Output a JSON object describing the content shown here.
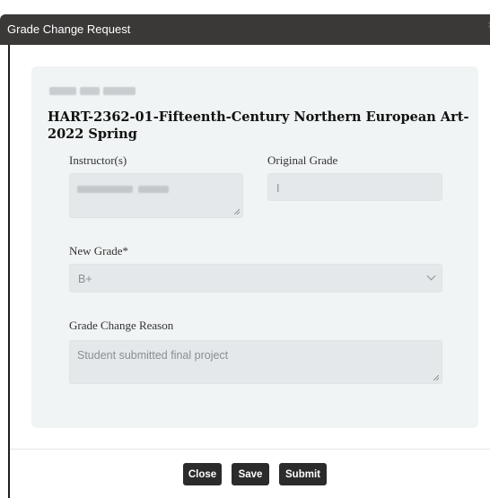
{
  "dialog": {
    "title": "Grade Change Request",
    "close_glyph": "×"
  },
  "course": {
    "title": "HART-2362-01-Fifteenth-Century Northern European Art-2022 Spring"
  },
  "fields": {
    "instructor_label": "Instructor(s)",
    "original_grade_label": "Original Grade",
    "original_grade_value": "I",
    "new_grade_label": "New Grade*",
    "new_grade_selected": "B+",
    "reason_label": "Grade Change Reason",
    "reason_value": "Student submitted final project"
  },
  "buttons": {
    "close": "Close",
    "save": "Save",
    "submit": "Submit"
  },
  "icons": {
    "dialog_close": "close-icon",
    "select_arrow": "chevron-down-icon",
    "textarea_resize": "resize-grip-icon"
  },
  "colors": {
    "titlebar": "#3b3838",
    "button": "#2b2b2b",
    "card": "#f1f4f4",
    "field": "#e4e8ea"
  }
}
